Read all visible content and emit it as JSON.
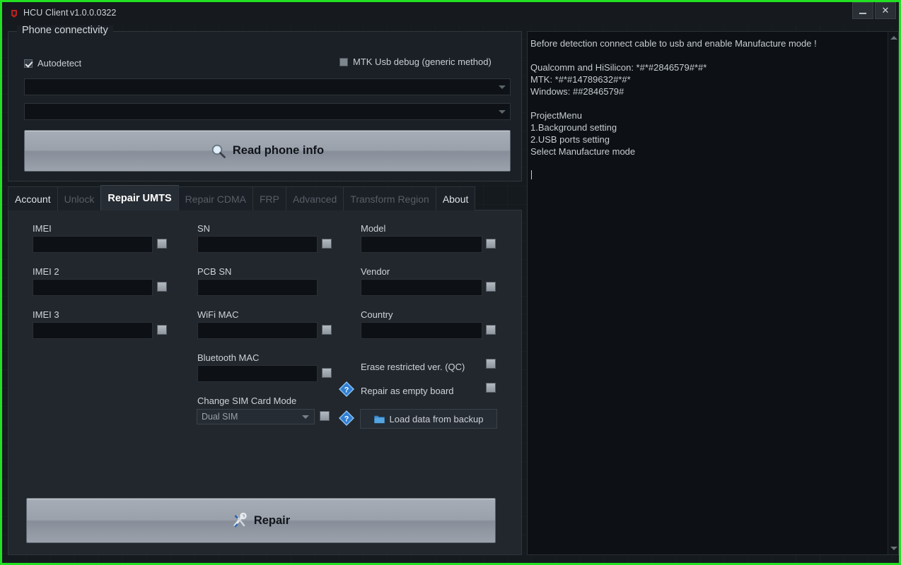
{
  "window": {
    "title": "HCU Client",
    "version": "v1.0.0.0322",
    "minimize_label": "",
    "close_label": "✕",
    "app_icon": "hcu-app-icon"
  },
  "connectivity": {
    "group_title": "Phone connectivity",
    "autodetect_label": "Autodetect",
    "autodetect_checked": true,
    "mtk_label": "MTK Usb debug (generic method)",
    "mtk_checked": false,
    "port_combo_value": "",
    "model_combo_value": "",
    "read_button_label": "Read phone info",
    "read_button_icon": "magnifier-icon"
  },
  "tabs": [
    {
      "label": "Account",
      "state": "enabled"
    },
    {
      "label": "Unlock",
      "state": "disabled"
    },
    {
      "label": "Repair UMTS",
      "state": "active"
    },
    {
      "label": "Repair CDMA",
      "state": "disabled"
    },
    {
      "label": "FRP",
      "state": "disabled"
    },
    {
      "label": "Advanced",
      "state": "disabled"
    },
    {
      "label": "Transform Region",
      "state": "disabled"
    },
    {
      "label": "About",
      "state": "enabled"
    }
  ],
  "repair_umts": {
    "fields": [
      {
        "label": "IMEI",
        "value": "",
        "has_checkbox": true
      },
      {
        "label": "IMEI 2",
        "value": "",
        "has_checkbox": true
      },
      {
        "label": "IMEI 3",
        "value": "",
        "has_checkbox": true
      },
      {
        "label": "SN",
        "value": "",
        "has_checkbox": true
      },
      {
        "label": "PCB SN",
        "value": "",
        "has_checkbox": false
      },
      {
        "label": "WiFi MAC",
        "value": "",
        "has_checkbox": true
      },
      {
        "label": "Bluetooth MAC",
        "value": "",
        "has_checkbox": true
      },
      {
        "label": "Model",
        "value": "",
        "has_checkbox": true
      },
      {
        "label": "Vendor",
        "value": "",
        "has_checkbox": true
      },
      {
        "label": "Country",
        "value": "",
        "has_checkbox": true
      }
    ],
    "sim_mode_label": "Change SIM Card Mode",
    "sim_mode_value": "Dual SIM",
    "erase_restricted_label": "Erase restricted ver. (QC)",
    "erase_restricted_checked": false,
    "repair_empty_board_label": "Repair as empty board",
    "repair_empty_board_checked": false,
    "load_backup_label": "Load data from backup",
    "load_backup_icon": "folder-icon",
    "help_icon": "question-diamond-icon",
    "repair_button_label": "Repair",
    "repair_button_icon": "tools-icon"
  },
  "log": {
    "text": "Before detection connect cable to usb and enable Manufacture mode !\n\nQualcomm and HiSilicon: *#*#2846579#*#*\nMTK: *#*#14789632#*#*\nWindows: ##2846579#\n\nProjectMenu\n1.Background setting\n2.USB ports setting\nSelect Manufacture mode",
    "scroll_up_icon": "scroll-up-arrow",
    "scroll_down_icon": "scroll-down-arrow"
  },
  "colors": {
    "frame_green": "#22e022",
    "panel_bg": "#22272d",
    "field_bg": "#0d1115",
    "accent_blue": "#2f7fd4"
  }
}
